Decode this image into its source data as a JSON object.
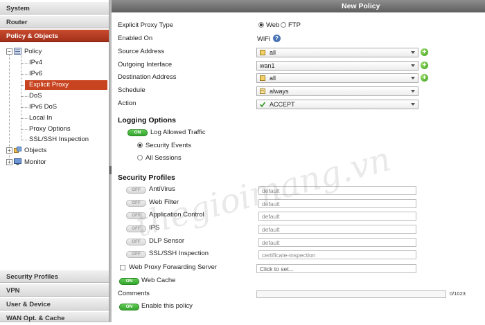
{
  "nav": {
    "sections_top": [
      "System",
      "Router",
      "Policy & Objects"
    ],
    "sections_bottom": [
      "Security Profiles",
      "VPN",
      "User & Device",
      "WAN Opt. & Cache"
    ],
    "tree": {
      "policy": "Policy",
      "children": [
        "IPv4",
        "IPv6",
        "Explicit Proxy",
        "DoS",
        "IPv6 DoS",
        "Local In",
        "Proxy Options",
        "SSL/SSH Inspection"
      ],
      "objects": "Objects",
      "monitor": "Monitor"
    }
  },
  "title": "New Policy",
  "form": {
    "proxy_type": {
      "label": "Explicit Proxy Type",
      "options": [
        "Web",
        "FTP"
      ],
      "selected": "Web"
    },
    "enabled_on": {
      "label": "Enabled On",
      "value": "WiFi",
      "help_icon": "?"
    },
    "source": {
      "label": "Source Address",
      "value": "all"
    },
    "outgoing": {
      "label": "Outgoing Interface",
      "value": "wan1"
    },
    "destination": {
      "label": "Destination Address",
      "value": "all"
    },
    "schedule": {
      "label": "Schedule",
      "value": "always"
    },
    "action": {
      "label": "Action",
      "value": "ACCEPT"
    }
  },
  "logging": {
    "title": "Logging Options",
    "toggle_state": "ON",
    "toggle_label": "Log Allowed Traffic",
    "options": [
      "Security Events",
      "All Sessions"
    ],
    "selected": "Security Events"
  },
  "security": {
    "title": "Security Profiles",
    "items": [
      {
        "state": "OFF",
        "label": "AntiVirus",
        "value": "default"
      },
      {
        "state": "OFF",
        "label": "Web Filter",
        "value": "default"
      },
      {
        "state": "OFF",
        "label": "Application Control",
        "value": "default"
      },
      {
        "state": "OFF",
        "label": "IPS",
        "value": "default"
      },
      {
        "state": "OFF",
        "label": "DLP Sensor",
        "value": "default"
      },
      {
        "state": "OFF",
        "label": "SSL/SSH Inspection",
        "value": "certificate-inspection"
      }
    ]
  },
  "forwarding": {
    "label": "Web Proxy Forwarding Server",
    "placeholder": "Click to set..."
  },
  "web_cache": {
    "state": "ON",
    "label": "Web Cache"
  },
  "comments": {
    "label": "Comments",
    "count": "0/1023"
  },
  "enable_policy": {
    "state": "ON",
    "label": "Enable this policy"
  },
  "watermark": "thegioimang.vn",
  "colors": {
    "accent": "#b8391c",
    "toggle_on": "#3cb034",
    "plus": "#4caf24"
  }
}
